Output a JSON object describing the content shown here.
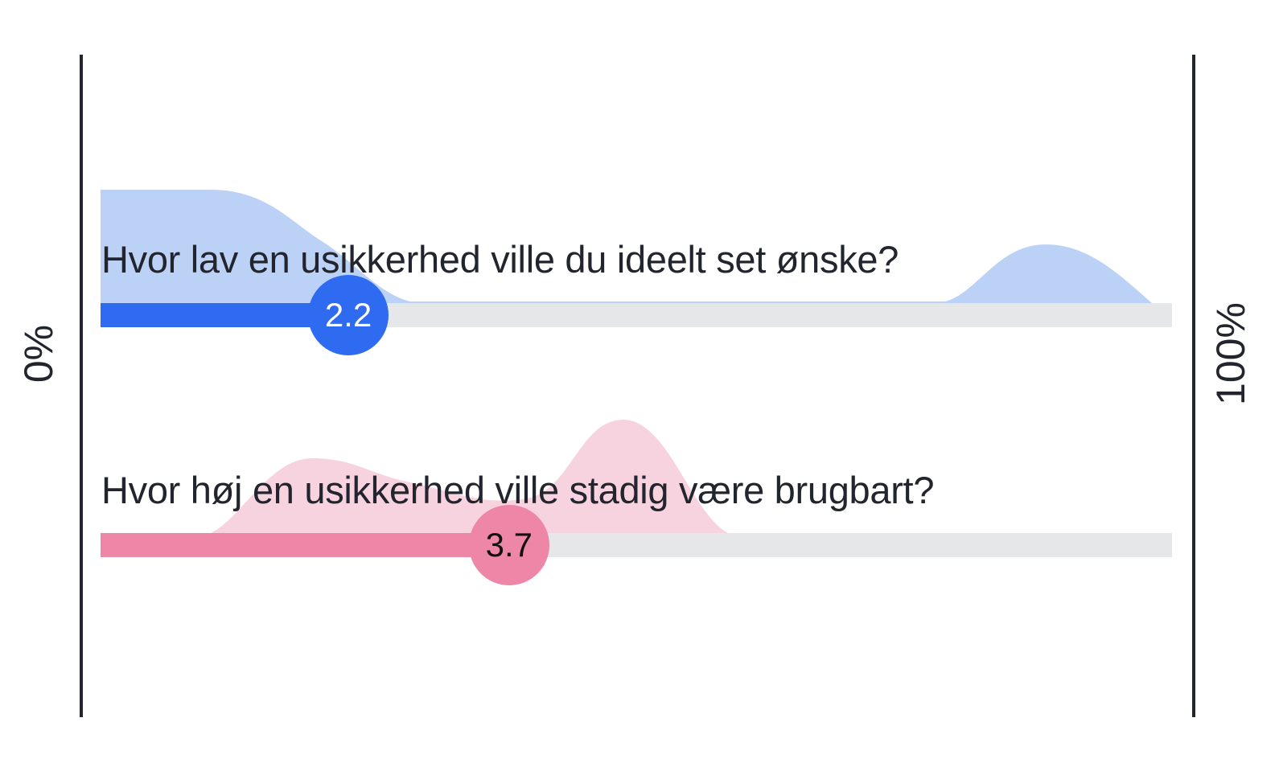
{
  "axis": {
    "min_label": "0%",
    "max_label": "100%",
    "line_color": "#22252e"
  },
  "sliders": [
    {
      "question": "Hvor lav en usikkerhed ville du ideelt set ønske?",
      "value": 2.2,
      "value_label": "2.2",
      "fill_fraction": 0.22,
      "color": "#2f6bf0",
      "distribution_color": "#bcd1f6"
    },
    {
      "question": "Hvor høj en usikkerhed ville stadig være brugbart?",
      "value": 3.7,
      "value_label": "3.7",
      "fill_fraction": 0.37,
      "color": "#ee86a8",
      "distribution_color": "#f7d2df"
    }
  ]
}
